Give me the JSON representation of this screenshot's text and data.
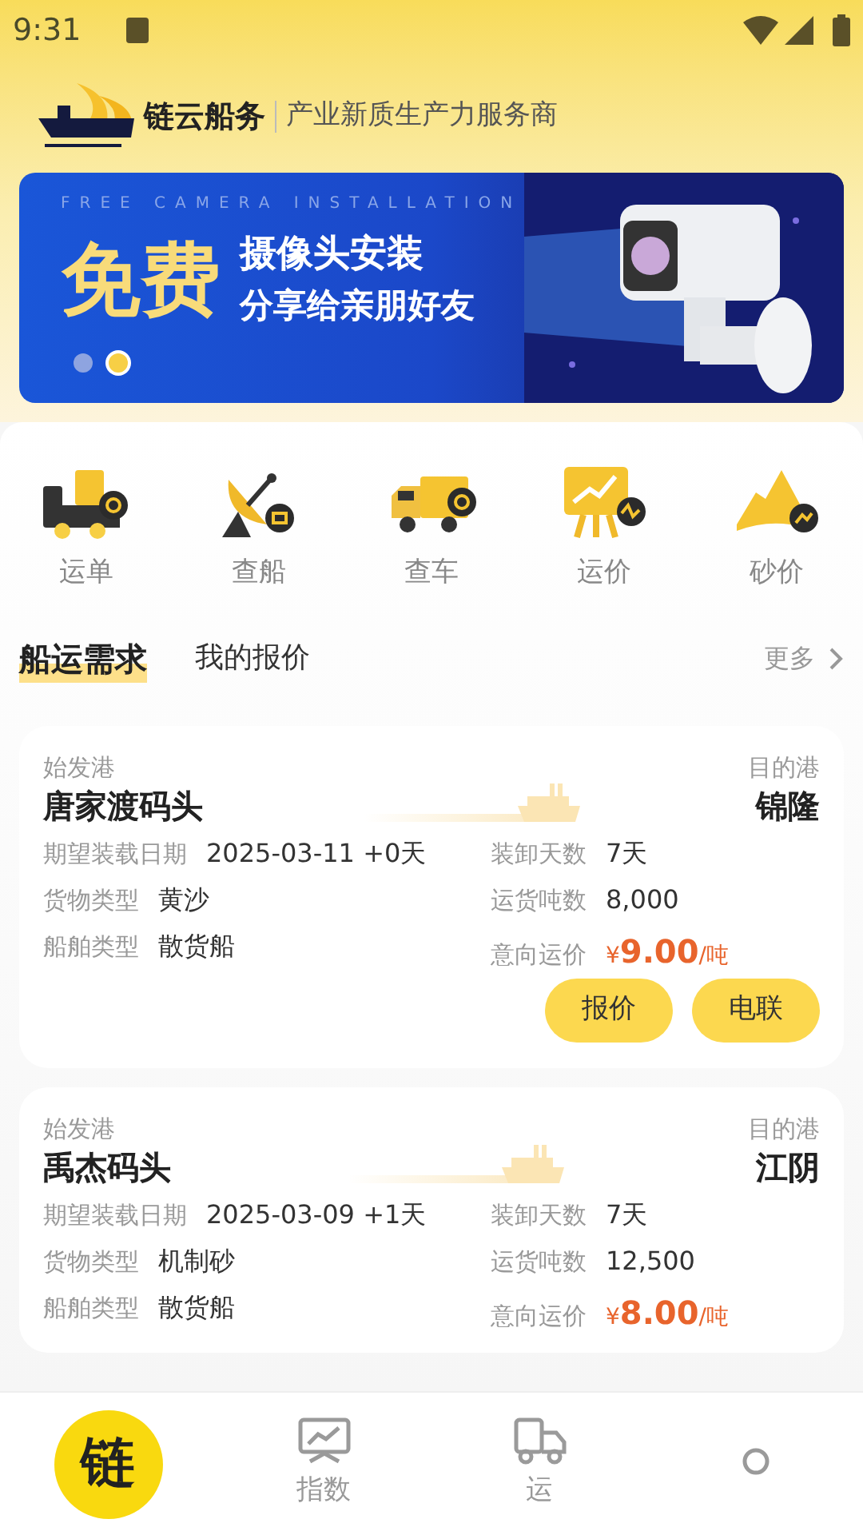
{
  "status_bar": {
    "time": "9:31"
  },
  "header": {
    "brand": "链云船务",
    "slogan": "产业新质生产力服务商"
  },
  "banner": {
    "caption": "FREE CAMERA INSTALLATION",
    "headline": "免费",
    "line_1": "摄像头安装",
    "line_2": "分享给亲朋好友",
    "dots": [
      {
        "selected": false
      },
      {
        "selected": true
      }
    ]
  },
  "shortcuts": [
    {
      "label": "运单",
      "kind": "waybill"
    },
    {
      "label": "查船",
      "kind": "ship"
    },
    {
      "label": "查车",
      "kind": "truck"
    },
    {
      "label": "运价",
      "kind": "freight"
    },
    {
      "label": "砂价",
      "kind": "sand"
    }
  ],
  "tabs": [
    {
      "label": "船运需求",
      "selected": true
    },
    {
      "label": "我的报价",
      "selected": false
    }
  ],
  "more": "更多",
  "cards": [
    {
      "from_label": "始发港",
      "from": "唐家渡码头",
      "to_label": "目的港",
      "to": "锦隆",
      "fields": [
        {
          "label": "期望装载日期",
          "value": "2025-03-11 +0天"
        },
        {
          "label": "装卸天数",
          "value": "7天"
        },
        {
          "label": "货物类型",
          "value": "黄沙"
        },
        {
          "label": "运货吨数",
          "value": "8,000"
        },
        {
          "label": "船舶类型",
          "value": "散货船"
        },
        {
          "label": "意向运价",
          "kind": "price",
          "currency": "¥",
          "value": "9.00",
          "unit": "/吨"
        }
      ],
      "buttons": [
        "报价",
        "电联"
      ]
    },
    {
      "from_label": "始发港",
      "from": "禹杰码头",
      "to_label": "目的港",
      "to": "江阴",
      "fields": [
        {
          "label": "期望装载日期",
          "value": "2025-03-09 +1天"
        },
        {
          "label": "装卸天数",
          "value": "7天"
        },
        {
          "label": "货物类型",
          "value": "机制砂"
        },
        {
          "label": "运货吨数",
          "value": "12,500"
        },
        {
          "label": "船舶类型",
          "value": "散货船"
        },
        {
          "label": "意向运价",
          "kind": "price",
          "currency": "¥",
          "value": "8.00",
          "unit": "/吨"
        }
      ]
    }
  ],
  "bottom_nav": [
    {
      "kind": "logo",
      "glyph": "链",
      "selected": true
    },
    {
      "kind": "index",
      "label": "指数",
      "selected": false
    },
    {
      "kind": "waybill",
      "label": "运",
      "selected": false
    },
    {
      "kind": "user",
      "selected": false
    }
  ]
}
